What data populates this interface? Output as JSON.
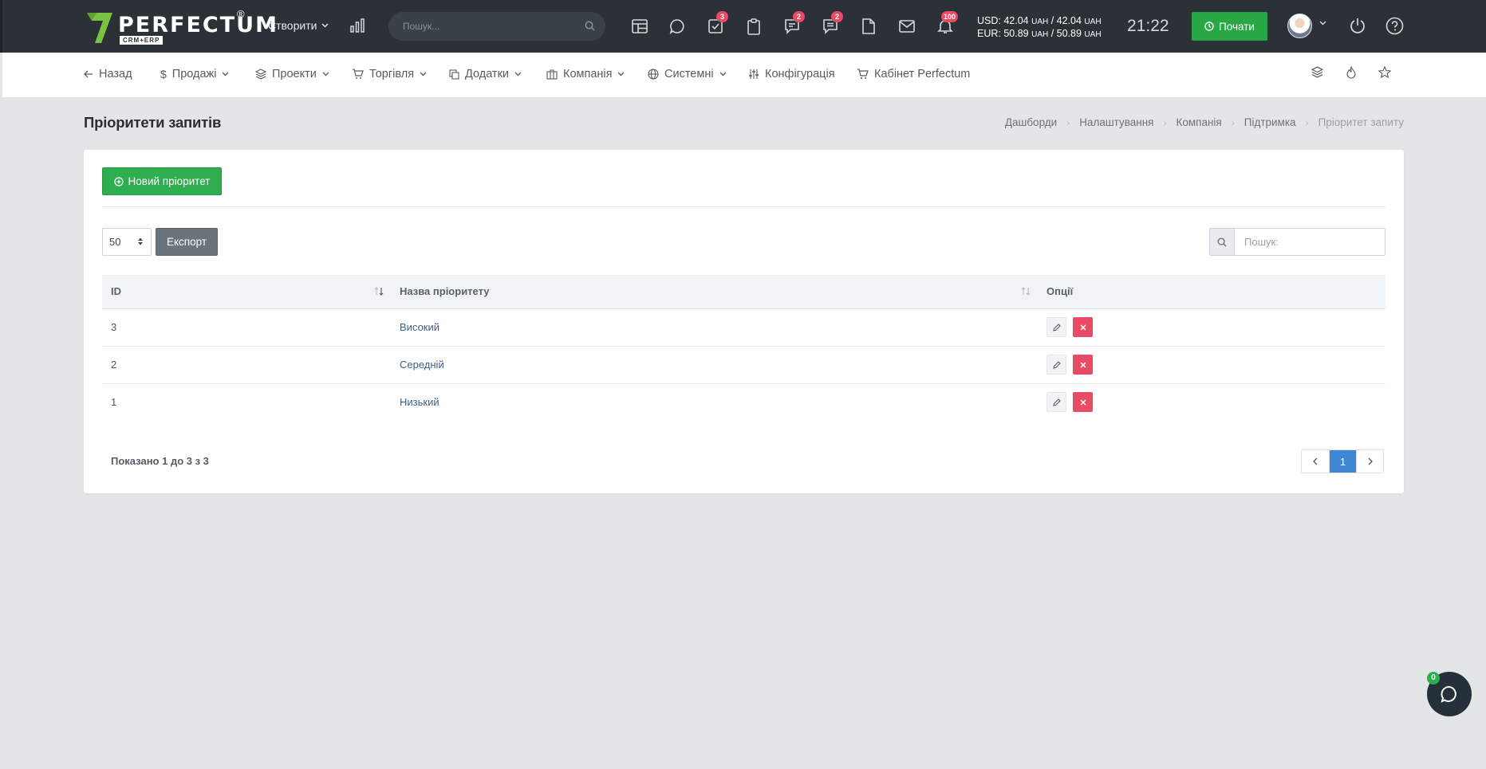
{
  "header": {
    "logo_text": "PERFECTUM",
    "logo_reg": "®",
    "logo_sub": "CRM+ERP",
    "create_label": "Створити",
    "search_placeholder": "Пошук...",
    "badges": {
      "tasks": "3",
      "chat": "2",
      "messages": "2",
      "notifications": "100"
    },
    "rates": {
      "usd_label": "USD: 42.04",
      "usd_unit1": "UAH",
      "usd_sep": " / 42.04",
      "usd_unit2": "UAH",
      "eur_label": "EUR: 50.89",
      "eur_unit1": "UAH",
      "eur_sep": " / 50.89",
      "eur_unit2": "UAH"
    },
    "time": "21:22",
    "start_label": "Почати",
    "icons": [
      "chart-icon",
      "table-icon",
      "chat-bubble-icon",
      "checklist-icon",
      "clipboard-icon",
      "chat-alt-icon",
      "message-icon",
      "file-icon",
      "mail-icon",
      "bell-icon",
      "power-icon",
      "help-icon"
    ]
  },
  "nav": {
    "back": "Назад",
    "sales": "Продажі",
    "projects": "Проекти",
    "trade": "Торгівля",
    "addons": "Додатки",
    "company": "Компанія",
    "system": "Системні",
    "config": "Конфігурація",
    "cabinet": "Кабінет Perfectum"
  },
  "page": {
    "title": "Пріоритети запитів",
    "breadcrumb": [
      "Дашборди",
      "Налаштування",
      "Компанія",
      "Підтримка",
      "Пріоритет запиту"
    ]
  },
  "toolbar": {
    "new_label": "Новий пріоритет",
    "length_value": "50",
    "export_label": "Експорт",
    "search_placeholder": "Пошук:"
  },
  "table": {
    "columns": [
      "ID",
      "Назва пріоритету",
      "Опції"
    ],
    "rows": [
      {
        "id": "3",
        "name": "Високий"
      },
      {
        "id": "2",
        "name": "Середній"
      },
      {
        "id": "1",
        "name": "Низький"
      }
    ]
  },
  "footer": {
    "info": "Показано 1 до 3 з 3",
    "current_page": "1"
  },
  "chat_fab": {
    "badge": "0"
  },
  "colors": {
    "header_bg": "#2b3137",
    "accent_green": "#2fae50",
    "danger": "#e84b63",
    "primary": "#3e85d2"
  }
}
